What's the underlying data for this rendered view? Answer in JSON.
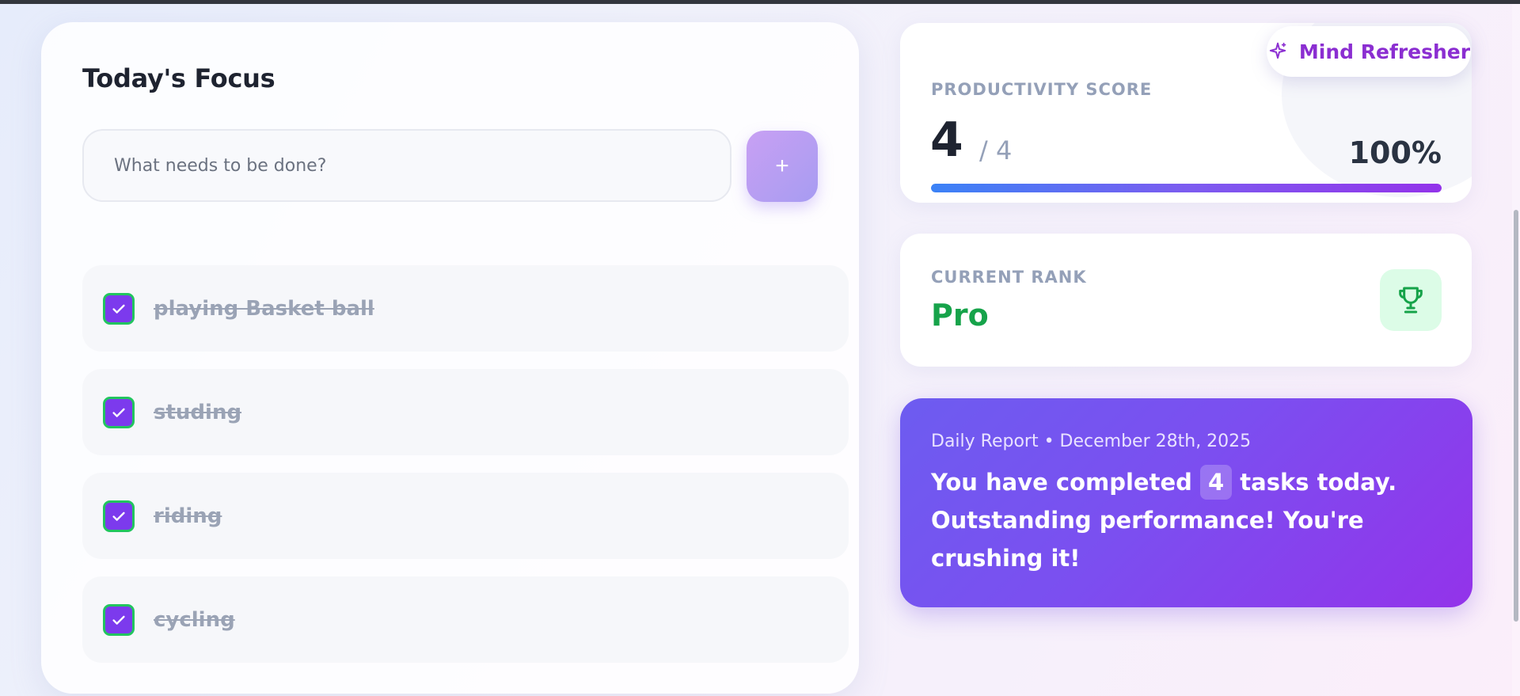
{
  "focus": {
    "title": "Today's Focus",
    "input_placeholder": "What needs to be done?",
    "add_button_label": "+",
    "tasks": [
      {
        "label": "playing Basket ball",
        "completed": true
      },
      {
        "label": "studing",
        "completed": true
      },
      {
        "label": "riding",
        "completed": true
      },
      {
        "label": "cycling",
        "completed": true
      }
    ]
  },
  "mind_refresher": {
    "label": "Mind Refresher",
    "icon": "sparkle-icon"
  },
  "productivity": {
    "label": "PRODUCTIVITY SCORE",
    "completed": "4",
    "total": "/ 4",
    "percent": "100%",
    "progress_fraction": 1.0
  },
  "rank": {
    "label": "CURRENT RANK",
    "value": "Pro",
    "icon": "trophy-icon"
  },
  "report": {
    "date": "Daily Report • December 28th, 2025",
    "message_before": "You have completed",
    "count": "4",
    "message_after": "tasks today. Outstanding performance! You're crushing it!"
  },
  "colors": {
    "accent": "#7c3aed",
    "success": "#16a34a",
    "checkbox_border": "#22c55e",
    "brand_purple": "#8b2ed1"
  }
}
